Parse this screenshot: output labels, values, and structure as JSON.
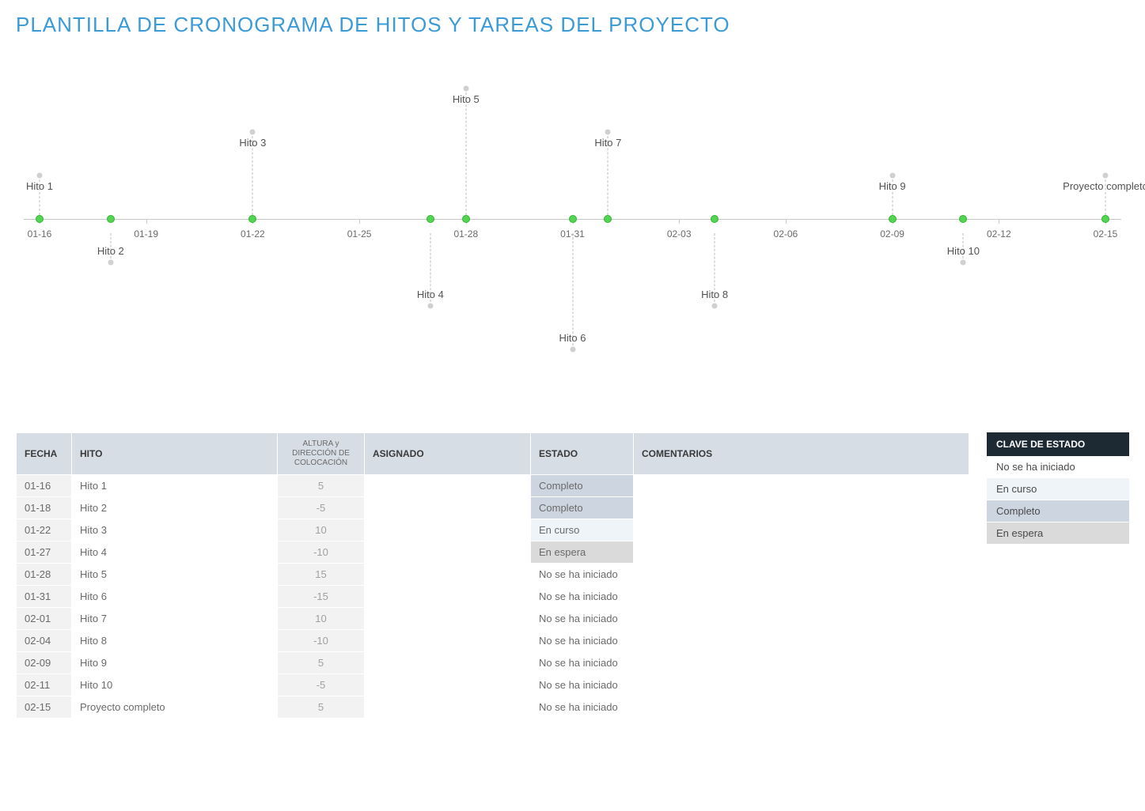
{
  "title": "PLANTILLA DE CRONOGRAMA DE HITOS Y TAREAS DEL PROYECTO",
  "chart_data": {
    "type": "timeline",
    "axis_ticks": [
      "01-16",
      "01-19",
      "01-22",
      "01-25",
      "01-28",
      "01-31",
      "02-03",
      "02-06",
      "02-09",
      "02-12",
      "02-15"
    ],
    "x_range": [
      "01-16",
      "02-15"
    ],
    "milestones": [
      {
        "date": "01-16",
        "label": "Hito 1",
        "placement": 5
      },
      {
        "date": "01-18",
        "label": "Hito 2",
        "placement": -5
      },
      {
        "date": "01-22",
        "label": "Hito 3",
        "placement": 10
      },
      {
        "date": "01-27",
        "label": "Hito 4",
        "placement": -10
      },
      {
        "date": "01-28",
        "label": "Hito 5",
        "placement": 15
      },
      {
        "date": "01-31",
        "label": "Hito 6",
        "placement": -15
      },
      {
        "date": "02-01",
        "label": "Hito 7",
        "placement": 10
      },
      {
        "date": "02-04",
        "label": "Hito 8",
        "placement": -10
      },
      {
        "date": "02-09",
        "label": "Hito 9",
        "placement": 5
      },
      {
        "date": "02-11",
        "label": "Hito 10",
        "placement": -5
      },
      {
        "date": "02-15",
        "label": "Proyecto completo",
        "placement": 5
      }
    ]
  },
  "table": {
    "headers": {
      "date": "FECHA",
      "milestone": "HITO",
      "placement": "ALTURA y DIRECCIÓN DE COLOCACIÓN",
      "assignee": "ASIGNADO",
      "status": "ESTADO",
      "comments": "COMENTARIOS"
    },
    "rows": [
      {
        "date": "01-16",
        "milestone": "Hito 1",
        "placement": "5",
        "assignee": "",
        "status": "Completo",
        "comments": ""
      },
      {
        "date": "01-18",
        "milestone": "Hito 2",
        "placement": "-5",
        "assignee": "",
        "status": "Completo",
        "comments": ""
      },
      {
        "date": "01-22",
        "milestone": "Hito 3",
        "placement": "10",
        "assignee": "",
        "status": "En curso",
        "comments": ""
      },
      {
        "date": "01-27",
        "milestone": "Hito 4",
        "placement": "-10",
        "assignee": "",
        "status": "En espera",
        "comments": ""
      },
      {
        "date": "01-28",
        "milestone": "Hito 5",
        "placement": "15",
        "assignee": "",
        "status": "No se ha iniciado",
        "comments": ""
      },
      {
        "date": "01-31",
        "milestone": "Hito 6",
        "placement": "-15",
        "assignee": "",
        "status": "No se ha iniciado",
        "comments": ""
      },
      {
        "date": "02-01",
        "milestone": "Hito 7",
        "placement": "10",
        "assignee": "",
        "status": "No se ha iniciado",
        "comments": ""
      },
      {
        "date": "02-04",
        "milestone": "Hito 8",
        "placement": "-10",
        "assignee": "",
        "status": "No se ha iniciado",
        "comments": ""
      },
      {
        "date": "02-09",
        "milestone": "Hito 9",
        "placement": "5",
        "assignee": "",
        "status": "No se ha iniciado",
        "comments": ""
      },
      {
        "date": "02-11",
        "milestone": "Hito 10",
        "placement": "-5",
        "assignee": "",
        "status": "No se ha iniciado",
        "comments": ""
      },
      {
        "date": "02-15",
        "milestone": "Proyecto completo",
        "placement": "5",
        "assignee": "",
        "status": "No se ha iniciado",
        "comments": ""
      }
    ]
  },
  "legend": {
    "header": "CLAVE DE ESTADO",
    "items": [
      "No se ha iniciado",
      "En curso",
      "Completo",
      "En espera"
    ]
  },
  "status_class_map": {
    "No se ha iniciado": "status-nostart",
    "En curso": "status-encurso",
    "Completo": "status-completo",
    "En espera": "status-enespera"
  }
}
